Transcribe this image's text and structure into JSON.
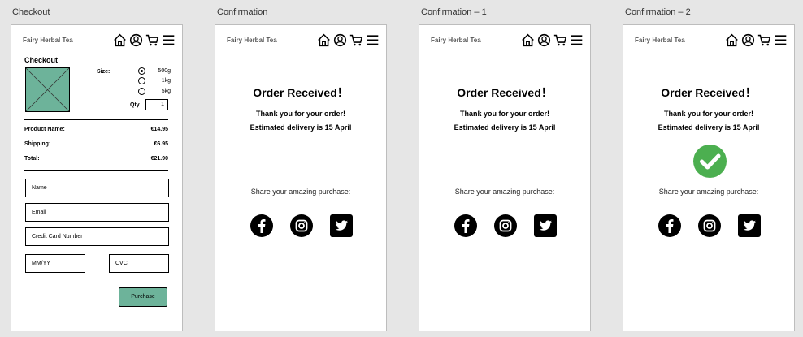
{
  "frames": {
    "checkout": "Checkout",
    "confirmation": "Confirmation",
    "confirmation_1": "Confirmation – 1",
    "confirmation_2": "Confirmation – 2"
  },
  "header": {
    "brand": "Fairy Herbal Tea",
    "icons": [
      "home-icon",
      "user-icon",
      "cart-icon",
      "menu-icon"
    ]
  },
  "checkout": {
    "title": "Checkout",
    "size_label": "Size:",
    "sizes": [
      {
        "label": "500g",
        "selected": true
      },
      {
        "label": "1kg",
        "selected": false
      },
      {
        "label": "5kg",
        "selected": false
      }
    ],
    "qty_label": "Qty",
    "qty_value": "1",
    "lines": [
      {
        "label": "Product Name:",
        "value": "€14.95"
      },
      {
        "label": "Shipping:",
        "value": "€6.95"
      },
      {
        "label": "Total:",
        "value": "€21.90"
      }
    ],
    "fields": {
      "name": "Name",
      "email": "Email",
      "card": "Credit Card Number",
      "mmyy": "MM/YY",
      "cvc": "CVC"
    },
    "purchase_label": "Purchase"
  },
  "confirmation": {
    "title": "Order Received！",
    "thanks": "Thank you for your order!",
    "delivery": "Estimated delivery is 15 April",
    "share": "Share your amazing purchase:",
    "social": [
      "facebook-icon",
      "instagram-icon",
      "twitter-icon"
    ]
  },
  "colors": {
    "accent": "#6db39a",
    "success": "#4caf50",
    "canvas": "#e6e6e6"
  }
}
